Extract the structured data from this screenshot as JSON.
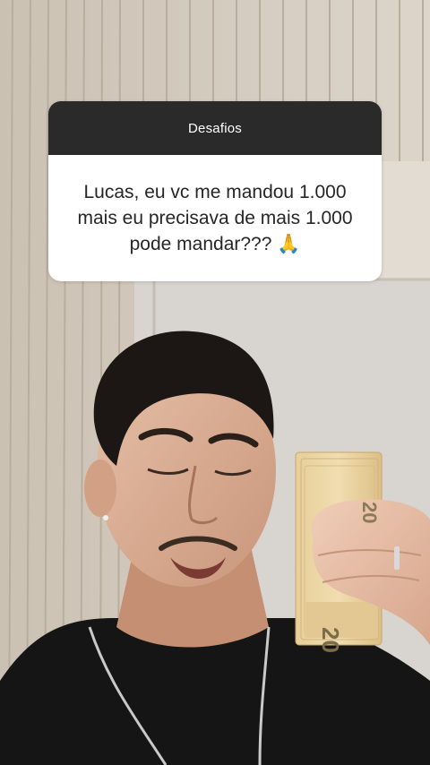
{
  "question_sticker": {
    "title": "Desafios",
    "text": "Lucas, eu vc me mandou 1.000 mais eu precisava de mais 1.000 pode mandar??? 🙏"
  },
  "banknotes": {
    "denomination_label": "20"
  }
}
